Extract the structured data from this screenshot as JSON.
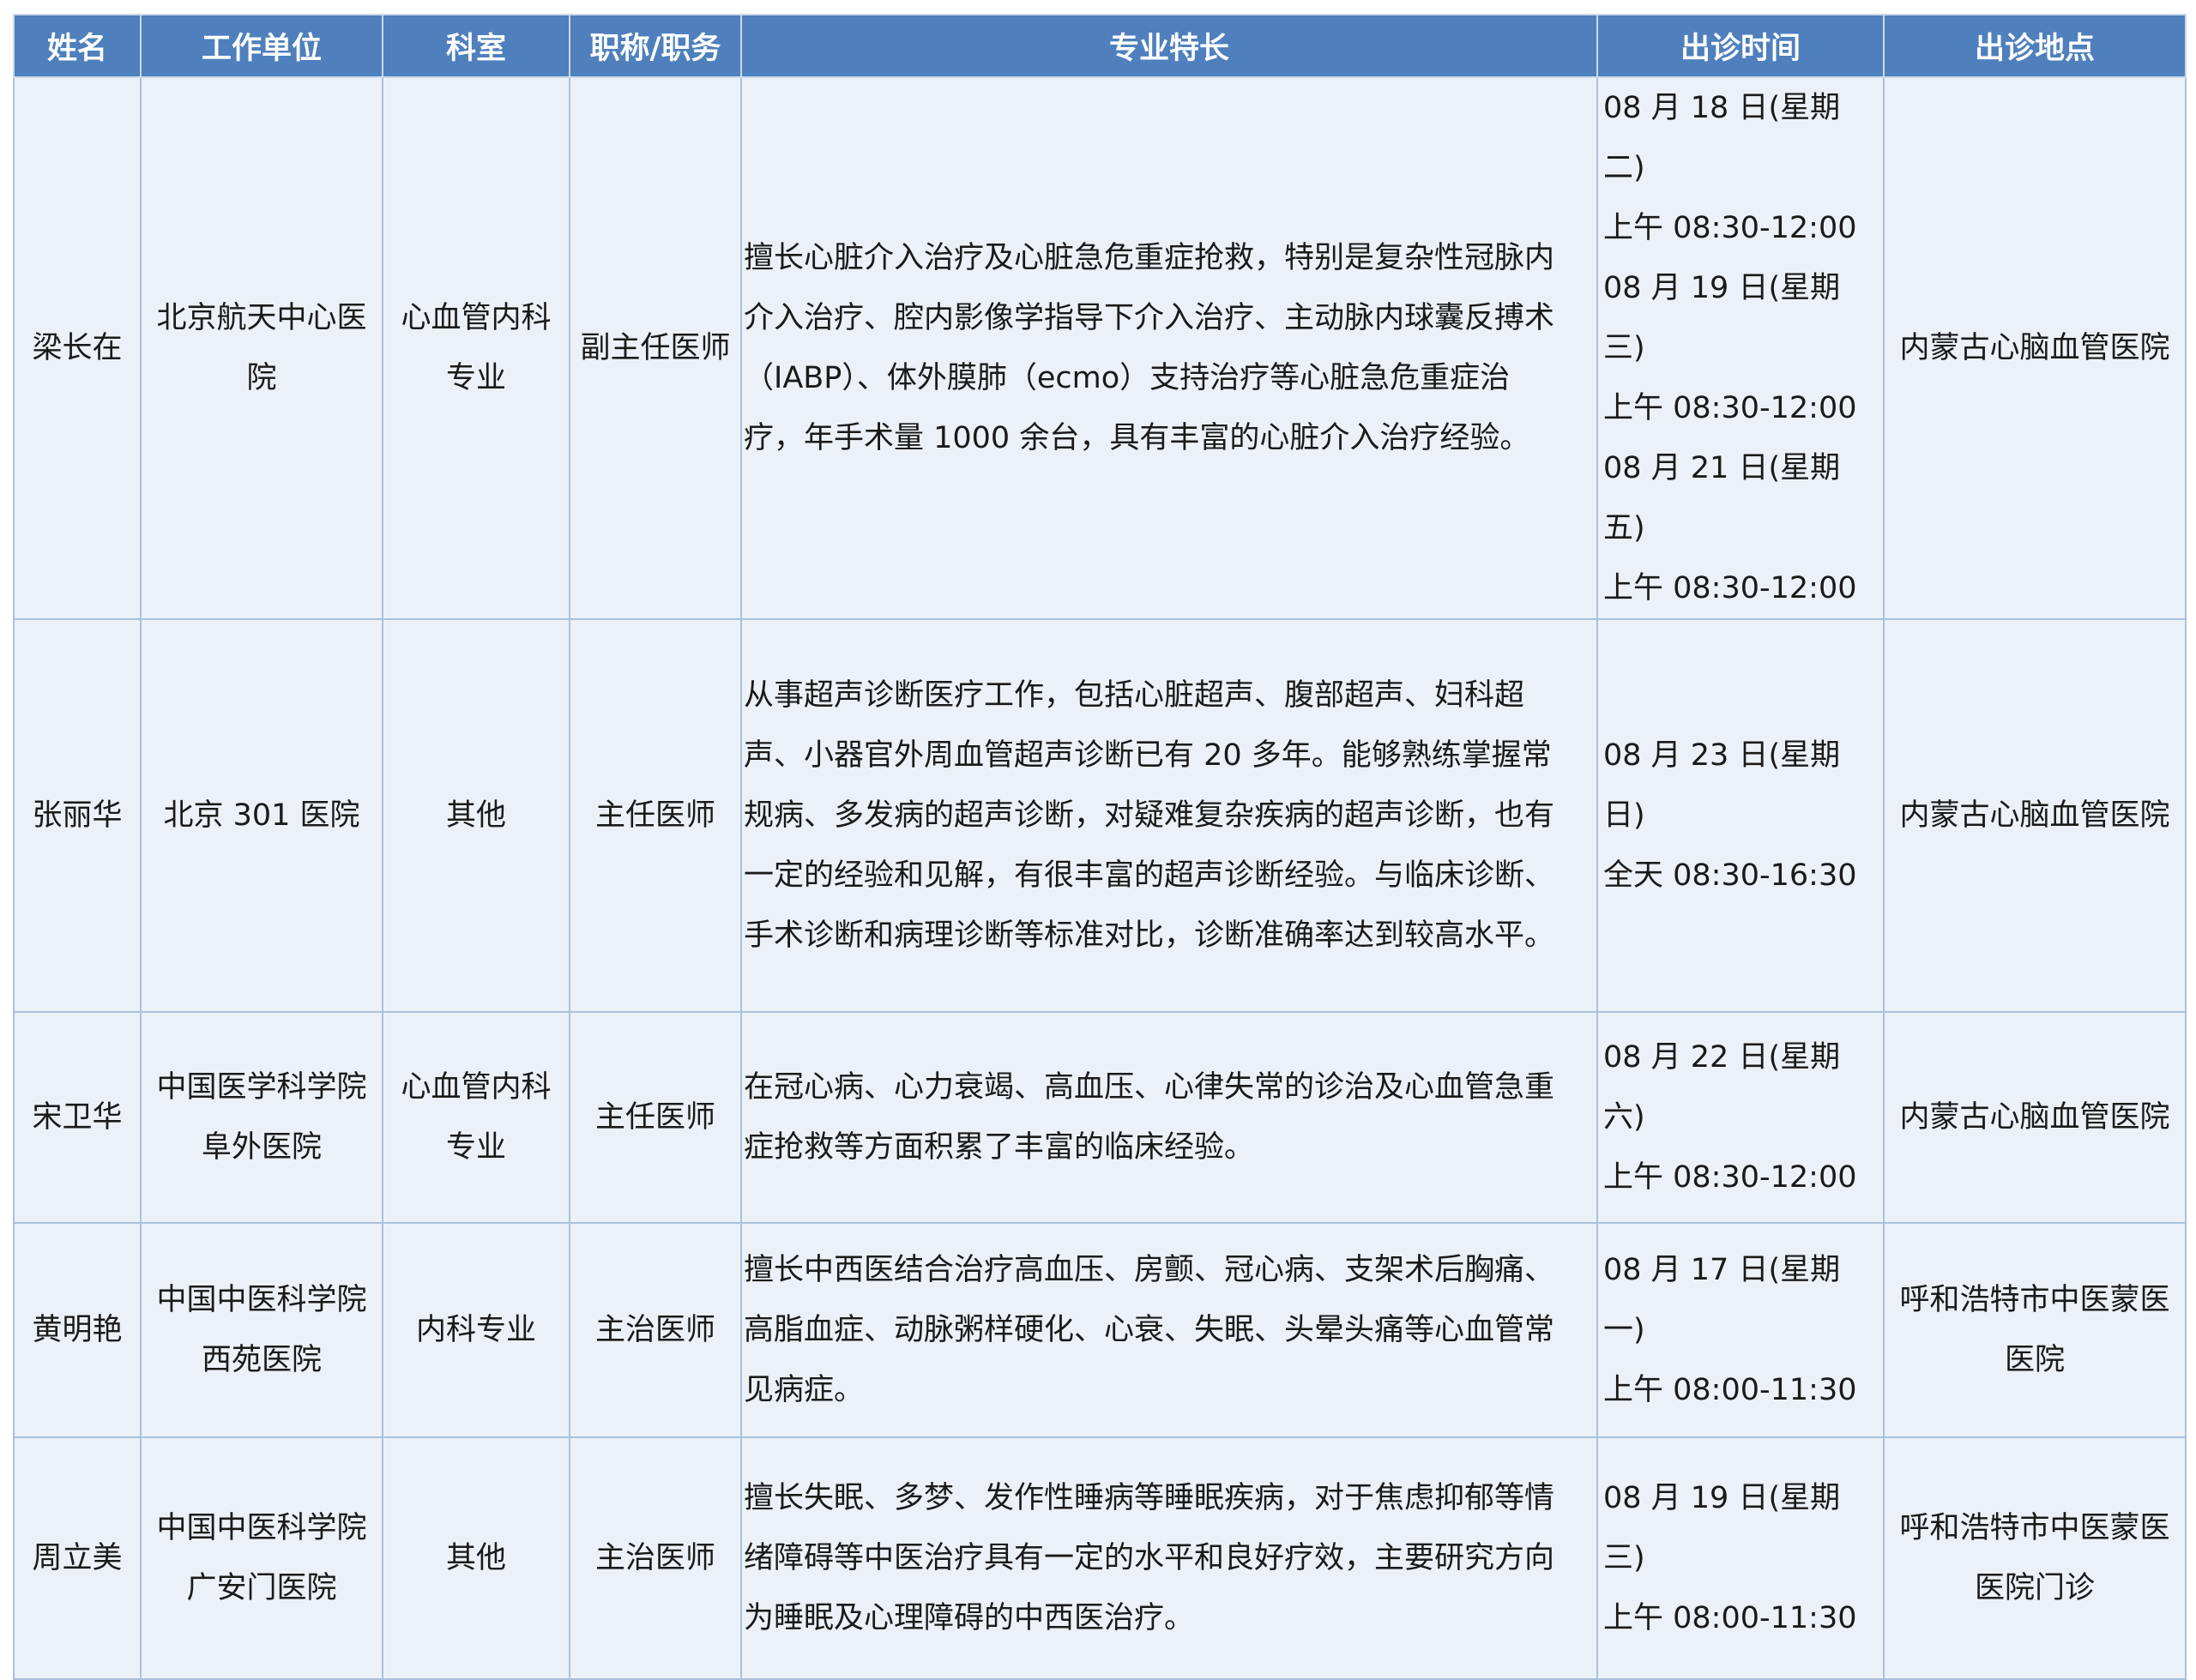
{
  "headers": {
    "name": "姓名",
    "unit": "工作单位",
    "department": "科室",
    "title": "职称/职务",
    "specialty": "专业特长",
    "time": "出诊时间",
    "location": "出诊地点"
  },
  "rows": [
    {
      "name": "梁长在",
      "unit": [
        "北京航天中心医",
        "院"
      ],
      "department": [
        "心血管内科",
        "专业"
      ],
      "title": "副主任医师",
      "specialty": [
        "擅长心脏介入治疗及心脏急危重症抢救，特别是复杂性冠脉内",
        "介入治疗、腔内影像学指导下介入治疗、主动脉内球囊反搏术",
        "（IABP）、体外膜肺（ecmo）支持治疗等心脏急危重症治",
        "疗，年手术量 1000 余台，具有丰富的心脏介入治疗经验。"
      ],
      "times": [
        "08 月 18 日(星期二)",
        "上午 08:30-12:00",
        "08 月 19 日(星期三)",
        "上午 08:30-12:00",
        "08 月 21 日(星期五)",
        "上午 08:30-12:00"
      ],
      "location": [
        "内蒙古心脑血管医院"
      ]
    },
    {
      "name": "张丽华",
      "unit": [
        "北京 301 医院"
      ],
      "department": [
        "其他"
      ],
      "title": "主任医师",
      "specialty": [
        "从事超声诊断医疗工作，包括心脏超声、腹部超声、妇科超",
        "声、小器官外周血管超声诊断已有 20 多年。能够熟练掌握常",
        "规病、多发病的超声诊断，对疑难复杂疾病的超声诊断，也有",
        "一定的经验和见解，有很丰富的超声诊断经验。与临床诊断、",
        "手术诊断和病理诊断等标准对比，诊断准确率达到较高水平。"
      ],
      "times": [
        "08 月 23 日(星期日)",
        "全天 08:30-16:30"
      ],
      "location": [
        "内蒙古心脑血管医院"
      ]
    },
    {
      "name": "宋卫华",
      "unit": [
        "中国医学科学院",
        "阜外医院"
      ],
      "department": [
        "心血管内科",
        "专业"
      ],
      "title": "主任医师",
      "specialty": [
        "在冠心病、心力衰竭、高血压、心律失常的诊治及心血管急重",
        "症抢救等方面积累了丰富的临床经验。"
      ],
      "times": [
        "08 月 22 日(星期六)",
        "上午 08:30-12:00"
      ],
      "location": [
        "内蒙古心脑血管医院"
      ]
    },
    {
      "name": "黄明艳",
      "unit": [
        "中国中医科学院",
        "西苑医院"
      ],
      "department": [
        "内科专业"
      ],
      "title": "主治医师",
      "specialty": [
        "擅长中西医结合治疗高血压、房颤、冠心病、支架术后胸痛、",
        "高脂血症、动脉粥样硬化、心衰、失眠、头晕头痛等心血管常",
        "见病症。"
      ],
      "times": [
        "08 月 17 日(星期一)",
        "上午 08:00-11:30"
      ],
      "location": [
        "呼和浩特市中医蒙医",
        "医院"
      ]
    },
    {
      "name": "周立美",
      "unit": [
        "中国中医科学院",
        "广安门医院"
      ],
      "department": [
        "其他"
      ],
      "title": "主治医师",
      "specialty": [
        "擅长失眠、多梦、发作性睡病等睡眠疾病，对于焦虑抑郁等情",
        "绪障碍等中医治疗具有一定的水平和良好疗效，主要研究方向",
        "为睡眠及心理障碍的中西医治疗。"
      ],
      "times": [
        "08 月 19 日(星期三)",
        "上午 08:00-11:30"
      ],
      "location": [
        "呼和浩特市中医蒙医",
        "医院门诊"
      ]
    }
  ]
}
